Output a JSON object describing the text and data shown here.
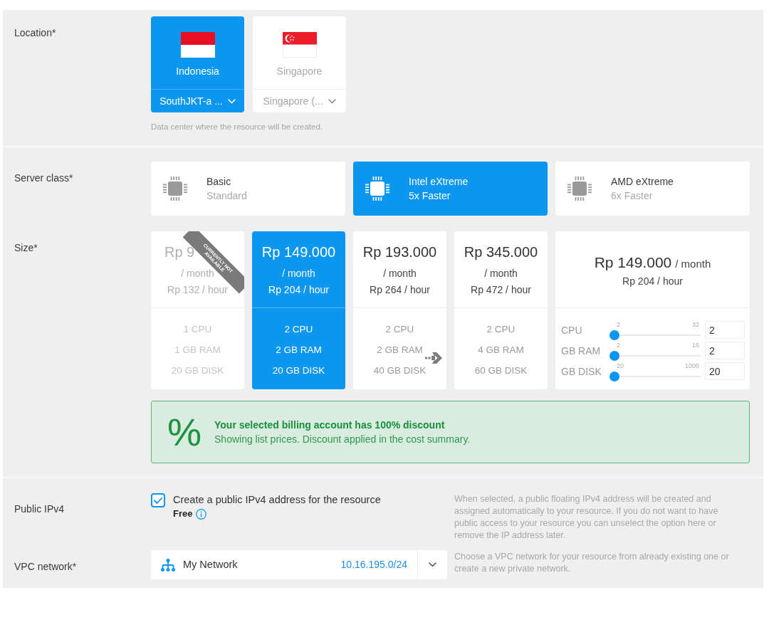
{
  "location": {
    "label": "Location*",
    "regions": [
      {
        "kind": "indonesia",
        "name": "Indonesia",
        "zone": "SouthJKT-a ...",
        "selected": true
      },
      {
        "kind": "singapore",
        "name": "Singapore",
        "zone": "Singapore (...",
        "selected": false
      }
    ],
    "hint": "Data center where the resource will be created."
  },
  "server_class": {
    "label": "Server class*",
    "options": [
      {
        "name": "Basic",
        "detail": "Standard",
        "selected": false
      },
      {
        "name": "Intel eXtreme",
        "detail": "5x Faster",
        "selected": true
      },
      {
        "name": "AMD eXtreme",
        "detail": "6x Faster",
        "selected": false
      }
    ]
  },
  "size": {
    "label": "Size*",
    "plans": [
      {
        "price": "Rp 9",
        "period": "/ month",
        "hourly": "Rp 132 / hour",
        "specs": [
          "1 CPU",
          "1 GB RAM",
          "20 GB DISK"
        ],
        "available": false,
        "ribbon": "CURRENTLY NOT AVAILABLE",
        "selected": false
      },
      {
        "price": "Rp 149.000",
        "period": "/ month",
        "hourly": "Rp 204 / hour",
        "specs": [
          "2 CPU",
          "2 GB RAM",
          "20 GB DISK"
        ],
        "available": true,
        "selected": true
      },
      {
        "price": "Rp 193.000",
        "period": "/ month",
        "hourly": "Rp 264 / hour",
        "specs": [
          "2 CPU",
          "2 GB RAM",
          "40 GB DISK"
        ],
        "available": true,
        "selected": false
      },
      {
        "price": "Rp 345.000",
        "period": "/ month",
        "hourly": "Rp 472 / hour",
        "specs": [
          "2 CPU",
          "4 GB RAM",
          "60 GB DISK"
        ],
        "available": true,
        "selected": false
      }
    ],
    "custom": {
      "price": "Rp 149.000",
      "period": "/ month",
      "hourly": "Rp 204 / hour",
      "selected": false,
      "sliders": [
        {
          "name": "CPU",
          "min": "2",
          "max": "32",
          "level": 0,
          "value": "2"
        },
        {
          "name": "GB RAM",
          "min": "2",
          "max": "16",
          "level": 0,
          "value": "2"
        },
        {
          "name": "GB DISK",
          "min": "20",
          "max": "1000",
          "level": 0,
          "value": "20"
        }
      ]
    }
  },
  "discount": {
    "symbol": "%",
    "title": "Your selected billing account has 100% discount",
    "text": "Showing list prices. Discount applied in the cost summary."
  },
  "public_ipv4": {
    "label": "Public IPv4",
    "checkbox": {
      "label": "Create a public IPv4 address for the resource",
      "checked": true
    },
    "price": "Free",
    "description": "When selected, a public floating IPv4 address will be created and assigned automatically to your resource. If you do not want to have public access to your resource you can unselect the option here or remove the IP address later."
  },
  "vpc_network": {
    "label": "VPC network*",
    "network": "My Network",
    "subnet": "10.16.195.0/24",
    "description": "Choose a VPC network for your resource from already existing one or create a new private network."
  }
}
